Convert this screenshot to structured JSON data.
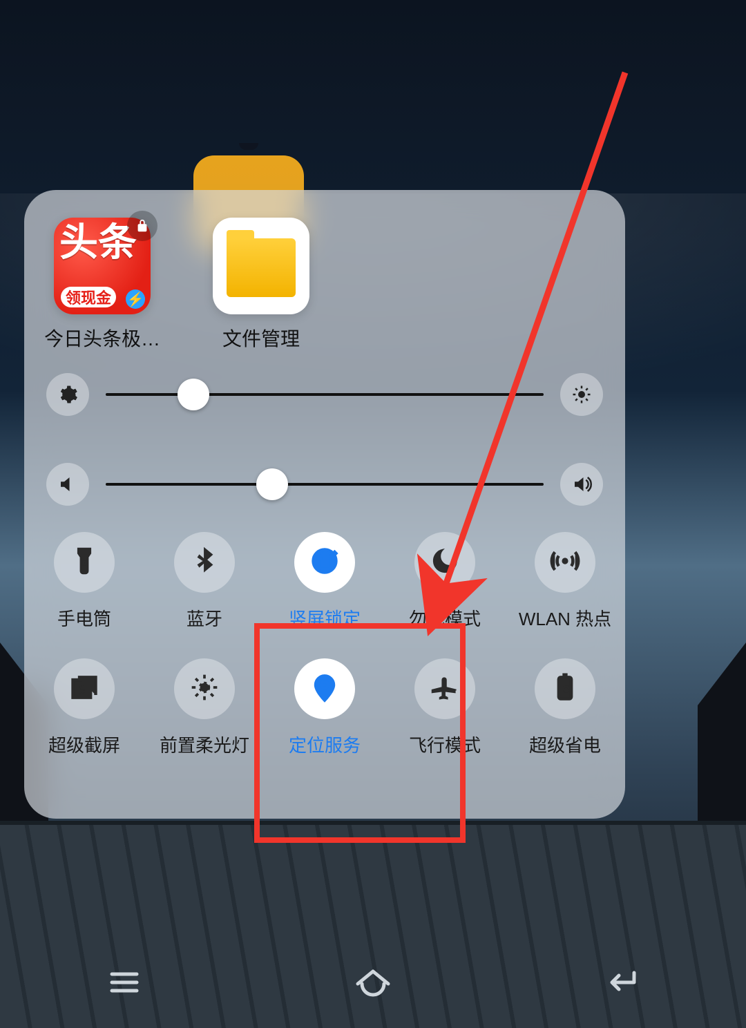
{
  "apps": [
    {
      "label": "今日头条极…",
      "main": "头条",
      "badge": "领现金",
      "locked": true
    },
    {
      "label": "文件管理"
    }
  ],
  "sliders": {
    "brightness": {
      "percent": 20
    },
    "volume": {
      "percent": 38
    }
  },
  "toggles": [
    {
      "label": "手电筒",
      "active": false
    },
    {
      "label": "蓝牙",
      "active": false
    },
    {
      "label": "竖屏锁定",
      "active": true
    },
    {
      "label": "勿扰模式",
      "active": false
    },
    {
      "label": "WLAN 热点",
      "active": false
    },
    {
      "label": "超级截屏",
      "active": false
    },
    {
      "label": "前置柔光灯",
      "active": false
    },
    {
      "label": "定位服务",
      "active": true
    },
    {
      "label": "飞行模式",
      "active": false
    },
    {
      "label": "超级省电",
      "active": false
    }
  ],
  "annotation": {
    "highlight_toggle": "定位服务",
    "arrow_target": "勿扰模式"
  }
}
